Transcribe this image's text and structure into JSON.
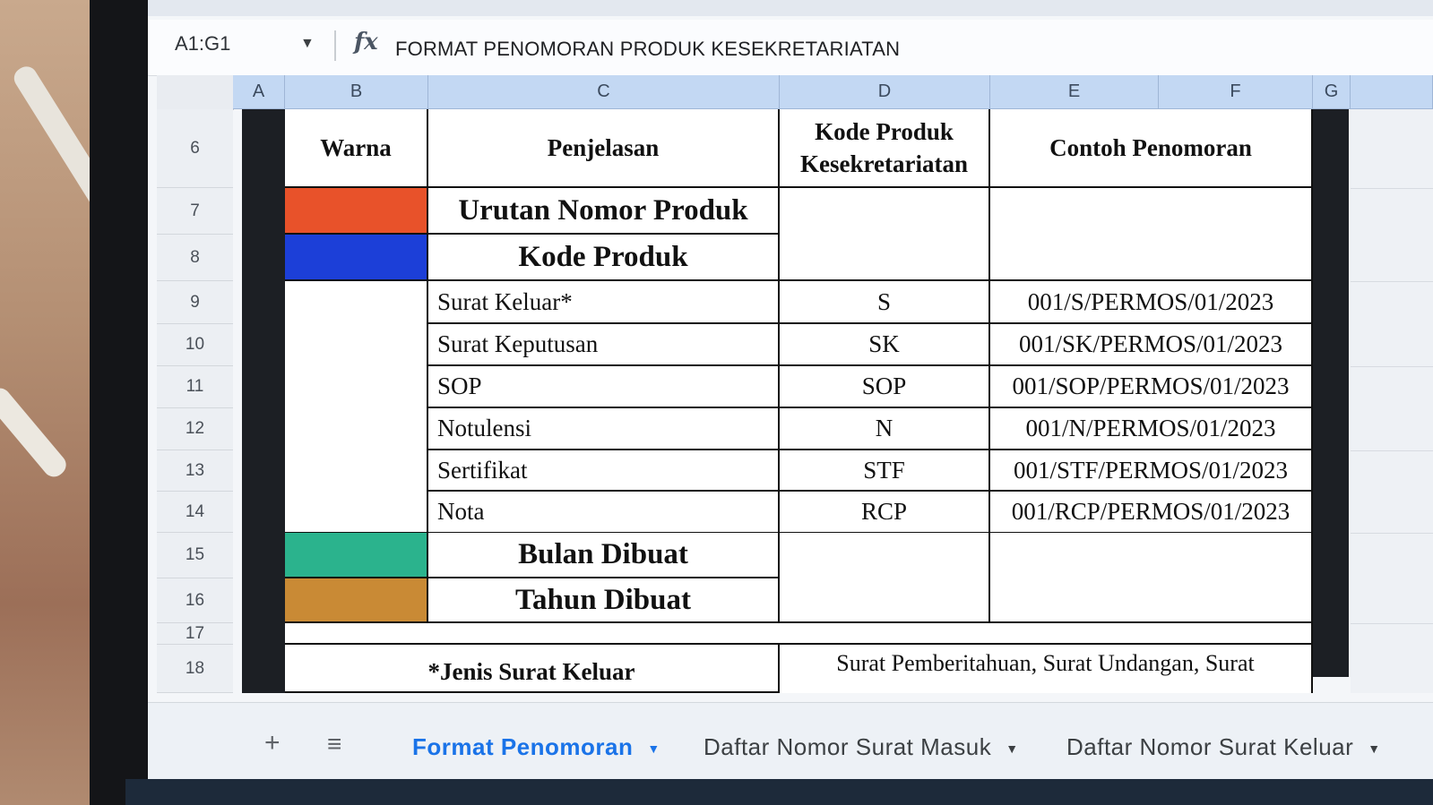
{
  "formula_bar": {
    "name_box": "A1:G1",
    "fx_label": "fx",
    "formula": "FORMAT PENOMORAN PRODUK KESEKRETARIATAN"
  },
  "columns": [
    "A",
    "B",
    "C",
    "D",
    "E",
    "F",
    "G"
  ],
  "rows": [
    "6",
    "7",
    "8",
    "9",
    "10",
    "11",
    "12",
    "13",
    "14",
    "15",
    "16",
    "17",
    "18"
  ],
  "table": {
    "headers": {
      "warna": "Warna",
      "penjelasan": "Penjelasan",
      "kode_line1": "Kode Produk",
      "kode_line2": "Kesekretariatan",
      "contoh": "Contoh Penomoran"
    },
    "colors": {
      "urutan": "#e8522a",
      "kode": "#1c3fd8",
      "bulan": "#2bb38d",
      "tahun": "#c98a35"
    },
    "sections": {
      "urutan": "Urutan Nomor Produk",
      "kode": "Kode Produk",
      "bulan": "Bulan Dibuat",
      "tahun": "Tahun Dibuat"
    },
    "items": [
      {
        "penjelasan": "Surat Keluar*",
        "kode": "S",
        "contoh": "001/S/PERMOS/01/2023"
      },
      {
        "penjelasan": "Surat Keputusan",
        "kode": "SK",
        "contoh": "001/SK/PERMOS/01/2023"
      },
      {
        "penjelasan": "SOP",
        "kode": "SOP",
        "contoh": "001/SOP/PERMOS/01/2023"
      },
      {
        "penjelasan": "Notulensi",
        "kode": "N",
        "contoh": "001/N/PERMOS/01/2023"
      },
      {
        "penjelasan": "Sertifikat",
        "kode": "STF",
        "contoh": "001/STF/PERMOS/01/2023"
      },
      {
        "penjelasan": "Nota",
        "kode": "RCP",
        "contoh": "001/RCP/PERMOS/01/2023"
      }
    ],
    "footnote_label": "*Jenis Surat Keluar",
    "footnote_text": "Surat Pemberitahuan, Surat Undangan, Surat"
  },
  "tabs": {
    "add_icon": "+",
    "list_icon": "≡",
    "items": [
      "Format Penomoran",
      "Daftar Nomor Surat Masuk",
      "Daftar Nomor Surat Keluar"
    ],
    "active": "Format Penomoran"
  }
}
